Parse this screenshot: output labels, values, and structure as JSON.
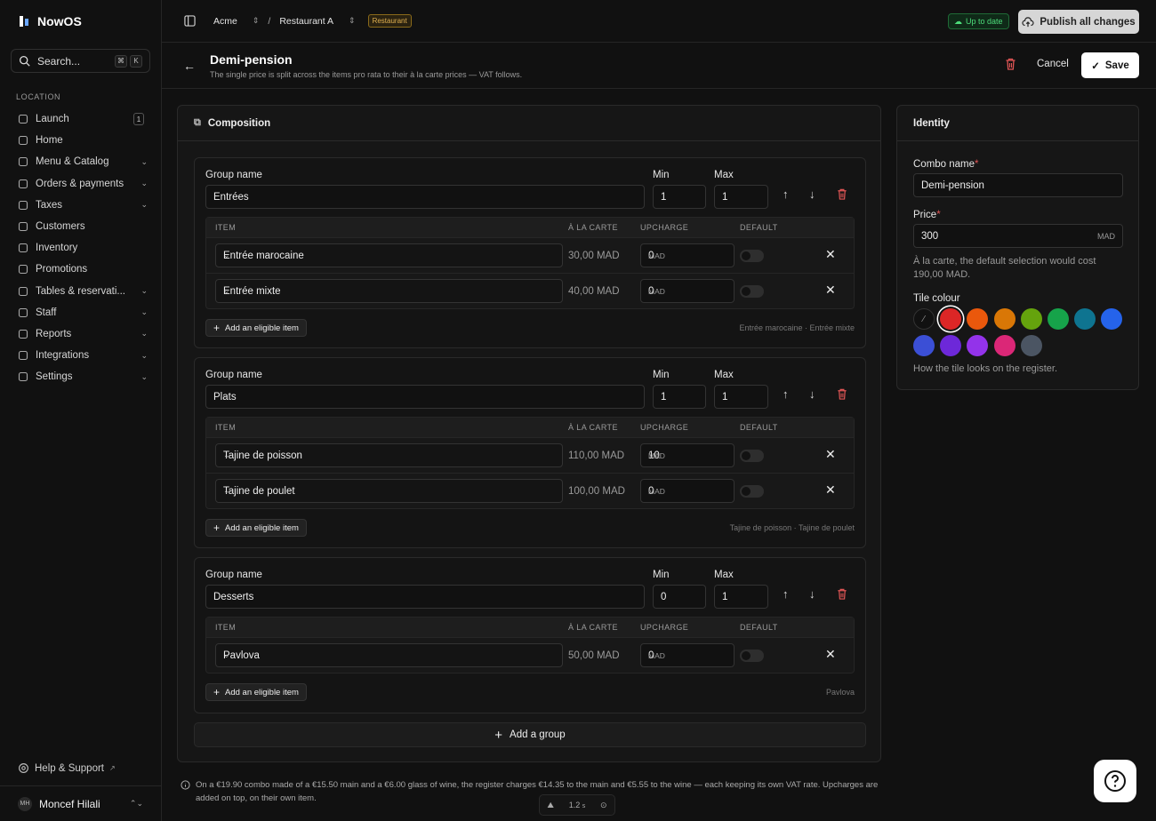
{
  "brand": {
    "name": "NowOS"
  },
  "search": {
    "label": "Search...",
    "kbd1": "⌘",
    "kbd2": "K"
  },
  "sidebar": {
    "section_label": "LOCATION",
    "items": [
      {
        "label": "Launch",
        "icon": "rocket-icon",
        "badge": "1"
      },
      {
        "label": "Home",
        "icon": "home-icon"
      },
      {
        "label": "Menu & Catalog",
        "icon": "grid-icon",
        "chevron": true
      },
      {
        "label": "Orders & payments",
        "icon": "receipt-icon",
        "chevron": true
      },
      {
        "label": "Taxes",
        "icon": "tag-icon",
        "chevron": true
      },
      {
        "label": "Customers",
        "icon": "users-icon"
      },
      {
        "label": "Inventory",
        "icon": "box-icon"
      },
      {
        "label": "Promotions",
        "icon": "gift-icon"
      },
      {
        "label": "Tables & reservati...",
        "icon": "layout-icon",
        "chevron": true
      },
      {
        "label": "Staff",
        "icon": "chart-icon",
        "chevron": true
      },
      {
        "label": "Reports",
        "icon": "rocket-icon",
        "chevron": true
      },
      {
        "label": "Integrations",
        "icon": "plug-icon",
        "chevron": true
      },
      {
        "label": "Settings",
        "icon": "gear-icon",
        "chevron": true
      }
    ],
    "help": "Help & Support",
    "user": {
      "initials": "MH",
      "name": "Moncef Hilali"
    }
  },
  "topbar": {
    "org": "Acme",
    "separator": "/",
    "location": "Restaurant A",
    "location_tag": "Restaurant",
    "status": "Up to date",
    "publish": "Publish all changes"
  },
  "header": {
    "title": "Demi-pension",
    "subtitle": "The single price is split across the items pro rata to their à la carte prices — VAT follows.",
    "cancel": "Cancel",
    "save": "Save"
  },
  "composition": {
    "title": "Composition",
    "labels": {
      "group_name": "Group name",
      "min": "Min",
      "max": "Max",
      "col_item": "ITEM",
      "col_alacarte": "À LA CARTE",
      "col_upcharge": "UPCHARGE",
      "col_default": "DEFAULT",
      "add_item": "Add an eligible item",
      "currency": "MAD"
    },
    "groups": [
      {
        "name": "Entrées",
        "min": "1",
        "max": "1",
        "items": [
          {
            "name": "Entrée marocaine",
            "alacarte": "30,00 MAD",
            "upcharge": "0"
          },
          {
            "name": "Entrée mixte",
            "alacarte": "40,00 MAD",
            "upcharge": "0"
          }
        ],
        "summary": "Entrée marocaine · Entrée mixte"
      },
      {
        "name": "Plats",
        "min": "1",
        "max": "1",
        "items": [
          {
            "name": "Tajine de poisson",
            "alacarte": "110,00 MAD",
            "upcharge": "10"
          },
          {
            "name": "Tajine de poulet",
            "alacarte": "100,00 MAD",
            "upcharge": "0"
          }
        ],
        "summary": "Tajine de poisson · Tajine de poulet"
      },
      {
        "name": "Desserts",
        "min": "0",
        "max": "1",
        "items": [
          {
            "name": "Pavlova",
            "alacarte": "50,00 MAD",
            "upcharge": "0"
          }
        ],
        "summary": "Pavlova"
      }
    ],
    "add_group": "Add a group"
  },
  "identity": {
    "title": "Identity",
    "combo_label": "Combo name",
    "combo_value": "Demi-pension",
    "price_label": "Price",
    "price_value": "300",
    "price_unit": "MAD",
    "price_hint": "À la carte, the default selection would cost 190,00 MAD.",
    "tile_label": "Tile colour",
    "tile_hint": "How the tile looks on the register.",
    "selected_colour": "#dc2626",
    "colours": [
      "none",
      "#dc2626",
      "#ea580c",
      "#d97706",
      "#65a30d",
      "#16a34a",
      "#0e7490",
      "#2563eb",
      "#3b4fd6",
      "#6d28d9",
      "#9333ea",
      "#db2777",
      "#4b5563"
    ]
  },
  "footnote": "On a €19.90 combo made of a €15.50 main and a €6.00 glass of wine, the register charges €14.35 to the main and €5.55 to the wine — each keeping its own VAT rate. Upcharges are added on top, on their own item.",
  "zoom": {
    "value": "1.2",
    "unit": "s"
  }
}
